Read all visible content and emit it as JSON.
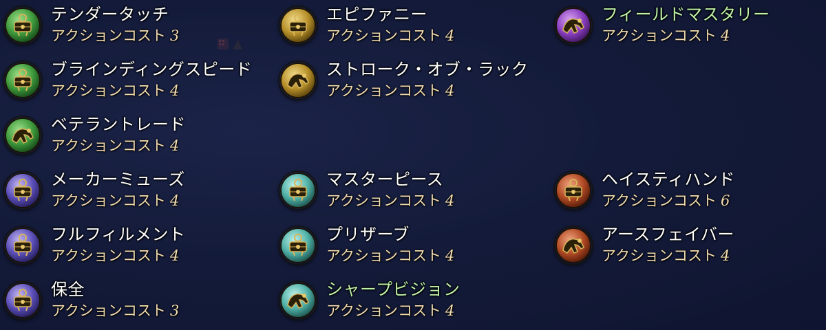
{
  "colors": {
    "name_default": "#ffffff",
    "name_highlight": "#bff2a8",
    "cost_text": "#f3dcae"
  },
  "cost_label": "アクションコスト",
  "columns": [
    [
      {
        "name": "テンダータッチ",
        "cost": "3",
        "icon": "green-crafter-action-icon",
        "tint": "green",
        "highlight": false
      },
      {
        "name": "ブラインディングスピード",
        "cost": "4",
        "icon": "green-crafter-action-icon",
        "tint": "green",
        "highlight": false
      },
      {
        "name": "ベテラントレード",
        "cost": "4",
        "icon": "green-crafter-hand-icon",
        "tint": "green",
        "highlight": false
      },
      {
        "name": "メーカーミューズ",
        "cost": "4",
        "icon": "purple-crafter-action-icon",
        "tint": "purple",
        "highlight": false
      },
      {
        "name": "フルフィルメント",
        "cost": "4",
        "icon": "purple-crafter-action-icon",
        "tint": "purple",
        "highlight": false
      },
      {
        "name": "保全",
        "cost": "3",
        "icon": "purple-crafter-action-icon",
        "tint": "purple",
        "highlight": false
      }
    ],
    [
      {
        "name": "エピファニー",
        "cost": "4",
        "icon": "gold-crafter-action-icon",
        "tint": "gold",
        "highlight": false
      },
      {
        "name": "ストローク・オブ・ラック",
        "cost": "4",
        "icon": "gold-crafter-hand-icon",
        "tint": "gold",
        "highlight": false
      },
      null,
      {
        "name": "マスターピース",
        "cost": "4",
        "icon": "teal-crafter-action-icon",
        "tint": "teal",
        "highlight": false
      },
      {
        "name": "プリザーブ",
        "cost": "4",
        "icon": "teal-crafter-action-icon",
        "tint": "teal",
        "highlight": false
      },
      {
        "name": "シャープビジョン",
        "cost": "4",
        "icon": "teal-crafter-hand-icon",
        "tint": "teal",
        "highlight": true
      }
    ],
    [
      {
        "name": "フィールドマスタリー",
        "cost": "4",
        "icon": "violet-crafter-hand-icon",
        "tint": "violet",
        "highlight": true
      },
      null,
      null,
      {
        "name": "ヘイスティハンド",
        "cost": "6",
        "icon": "red-crafter-action-icon",
        "tint": "red",
        "highlight": false
      },
      {
        "name": "アースフェイバー",
        "cost": "4",
        "icon": "red-crafter-hand-icon",
        "tint": "red",
        "highlight": false
      },
      null
    ]
  ],
  "tints": {
    "green": {
      "light": "#9fe08a",
      "mid": "#3f9a3c",
      "dark": "#0f3d14"
    },
    "purple": {
      "light": "#c3b9f2",
      "mid": "#5b4fb8",
      "dark": "#1c1650"
    },
    "gold": {
      "light": "#f2dc8a",
      "mid": "#b7902a",
      "dark": "#4a3608"
    },
    "teal": {
      "light": "#bdf1ea",
      "mid": "#4fb0a6",
      "dark": "#13433f"
    },
    "violet": {
      "light": "#d9a6f2",
      "mid": "#8a3fc0",
      "dark": "#341050"
    },
    "red": {
      "light": "#f0a27e",
      "mid": "#b04a24",
      "dark": "#4a1406"
    }
  }
}
